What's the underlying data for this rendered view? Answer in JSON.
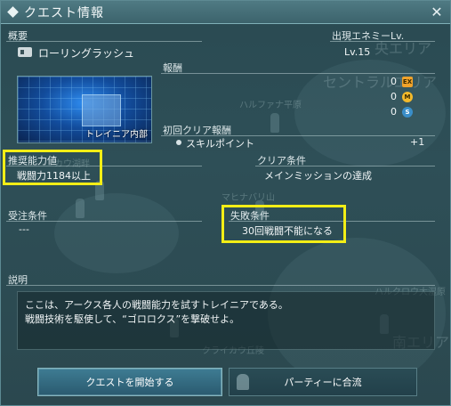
{
  "window": {
    "title": "クエスト情報"
  },
  "map_labels": [
    "央エリア",
    "セントラルエリア",
    "ハルファナ平原",
    "マヒナバリ山",
    "ハルクロウ大湿原",
    "南エリア",
    "クライカウ丘陵",
    "カウ湖畔"
  ],
  "overview": {
    "label": "概要",
    "quest_name": "ローリングラッシュ"
  },
  "enemy": {
    "label": "出現エネミーLv.",
    "level": "Lv.15"
  },
  "area": {
    "caption": "トレイニア内部"
  },
  "rewards": {
    "label": "報酬",
    "items": [
      {
        "value": "0",
        "icon": "exp-icon"
      },
      {
        "value": "0",
        "icon": "meseta-icon"
      },
      {
        "value": "0",
        "icon": "s-coin-icon"
      }
    ]
  },
  "first_clear": {
    "label": "初回クリア報酬",
    "item": "スキルポイント",
    "amount": "+1"
  },
  "recommended": {
    "label": "推奨能力値",
    "value": "戦闘力1184以上"
  },
  "clear_condition": {
    "label": "クリア条件",
    "value": "メインミッションの達成"
  },
  "accept_condition": {
    "label": "受注条件",
    "value": "---"
  },
  "failure_condition": {
    "label": "失敗条件",
    "value": "30回戦闘不能になる"
  },
  "description": {
    "label": "説明",
    "line1": "ここは、アークス各人の戦闘能力を試すトレイニアである。",
    "line2": "戦闘技術を駆使して、“ゴロロクス”を撃破せよ。"
  },
  "buttons": {
    "start": "クエストを開始する",
    "join": "パーティーに合流"
  },
  "colors": {
    "highlight": "#f3ee16",
    "window_bg": "#2e4f57",
    "title_bar": "#4f7a83"
  }
}
